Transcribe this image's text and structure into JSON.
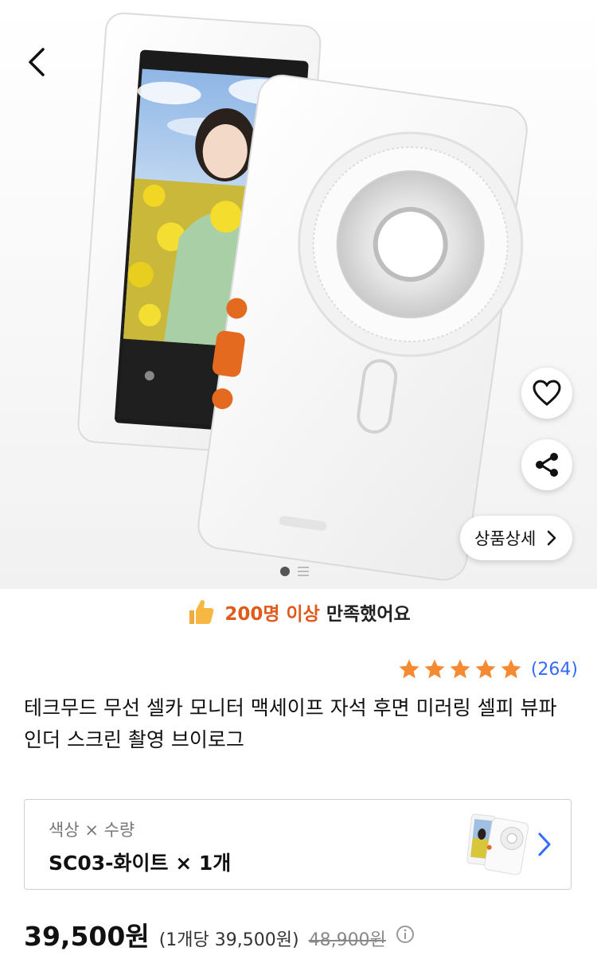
{
  "nav": {
    "back_icon": "chevron-left-icon"
  },
  "hero": {
    "pager": {
      "current": 1,
      "total": 2
    },
    "actions": {
      "wishlist_icon": "heart-icon",
      "share_icon": "share-icon"
    },
    "detail_button": {
      "label": "상품상세",
      "icon": "chevron-right-icon"
    }
  },
  "satisfaction": {
    "icon": "thumbs-up-icon",
    "highlight": "200명 이상",
    "text": "만족했어요"
  },
  "rating": {
    "stars": 5,
    "count": "(264)"
  },
  "product": {
    "title": "테크무드 무선 셀카 모니터 맥세이프 자석 후면 미러링 셀피 뷰파인더 스크린 촬영 브이로그"
  },
  "option": {
    "label": "색상 × 수량",
    "value": "SC03-화이트 × 1개"
  },
  "price": {
    "sale": "39,500원",
    "unit": "(1개당 39,500원)",
    "original": "48,900원",
    "info_icon": "info-icon"
  },
  "colors": {
    "accent": "#346aff",
    "highlight": "#e05a1c",
    "star": "#f58a32"
  }
}
